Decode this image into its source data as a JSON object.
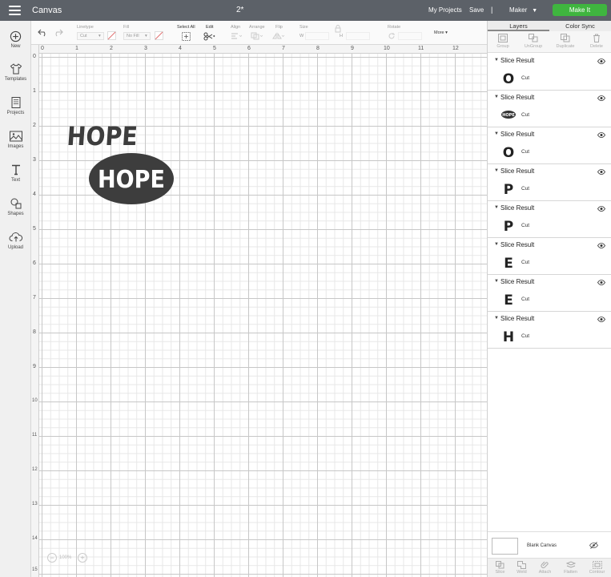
{
  "topbar": {
    "title": "Canvas",
    "project": "2*",
    "my_projects": "My Projects",
    "save": "Save",
    "separator": "|",
    "machine": "Maker",
    "make_it": "Make It"
  },
  "sidebar": {
    "items": [
      {
        "label": "New",
        "icon": "plus-circle-icon"
      },
      {
        "label": "Templates",
        "icon": "shirt-icon"
      },
      {
        "label": "Projects",
        "icon": "projects-icon"
      },
      {
        "label": "Images",
        "icon": "image-icon"
      },
      {
        "label": "Text",
        "icon": "text-icon"
      },
      {
        "label": "Shapes",
        "icon": "shapes-icon"
      },
      {
        "label": "Upload",
        "icon": "upload-cloud-icon"
      }
    ]
  },
  "toolbar": {
    "linetype_label": "Linetype",
    "linetype_value": "Cut",
    "fill_label": "Fill",
    "fill_value": "No Fill",
    "select_all": "Select All",
    "edit": "Edit",
    "align": "Align",
    "arrange": "Arrange",
    "flip": "Flip",
    "size": "Size",
    "size_w": "W",
    "size_h": "H",
    "rotate": "Rotate",
    "more": "More"
  },
  "rulers": {
    "top": [
      "0",
      "1",
      "2",
      "3",
      "4",
      "5",
      "6",
      "7",
      "8",
      "9",
      "10",
      "11",
      "12"
    ],
    "left": [
      "0",
      "1",
      "2",
      "3",
      "4",
      "5",
      "6",
      "7",
      "8",
      "9",
      "10",
      "11",
      "12",
      "13",
      "14",
      "15"
    ]
  },
  "canvas": {
    "word_text": "HOPE",
    "oval_text": "HOPE",
    "zoom": "100%"
  },
  "panel": {
    "tabs": [
      "Layers",
      "Color Sync"
    ],
    "tools": [
      "Group",
      "UnGroup",
      "Duplicate",
      "Delete"
    ],
    "layers": [
      {
        "name": "Slice Result",
        "glyph": "O",
        "op": "Cut"
      },
      {
        "name": "Slice Result",
        "glyph": "HOPE",
        "op": "Cut"
      },
      {
        "name": "Slice Result",
        "glyph": "O",
        "op": "Cut"
      },
      {
        "name": "Slice Result",
        "glyph": "P",
        "op": "Cut"
      },
      {
        "name": "Slice Result",
        "glyph": "P",
        "op": "Cut"
      },
      {
        "name": "Slice Result",
        "glyph": "E",
        "op": "Cut"
      },
      {
        "name": "Slice Result",
        "glyph": "E",
        "op": "Cut"
      },
      {
        "name": "Slice Result",
        "glyph": "H",
        "op": "Cut"
      }
    ],
    "blank_canvas": "Blank Canvas",
    "bottom_tools": [
      "Slice",
      "Weld",
      "Attach",
      "Flatten",
      "Contour"
    ]
  },
  "colors": {
    "topbar": "#5c6168",
    "make_it": "#3fb53f",
    "shape": "#3d3d3d"
  }
}
